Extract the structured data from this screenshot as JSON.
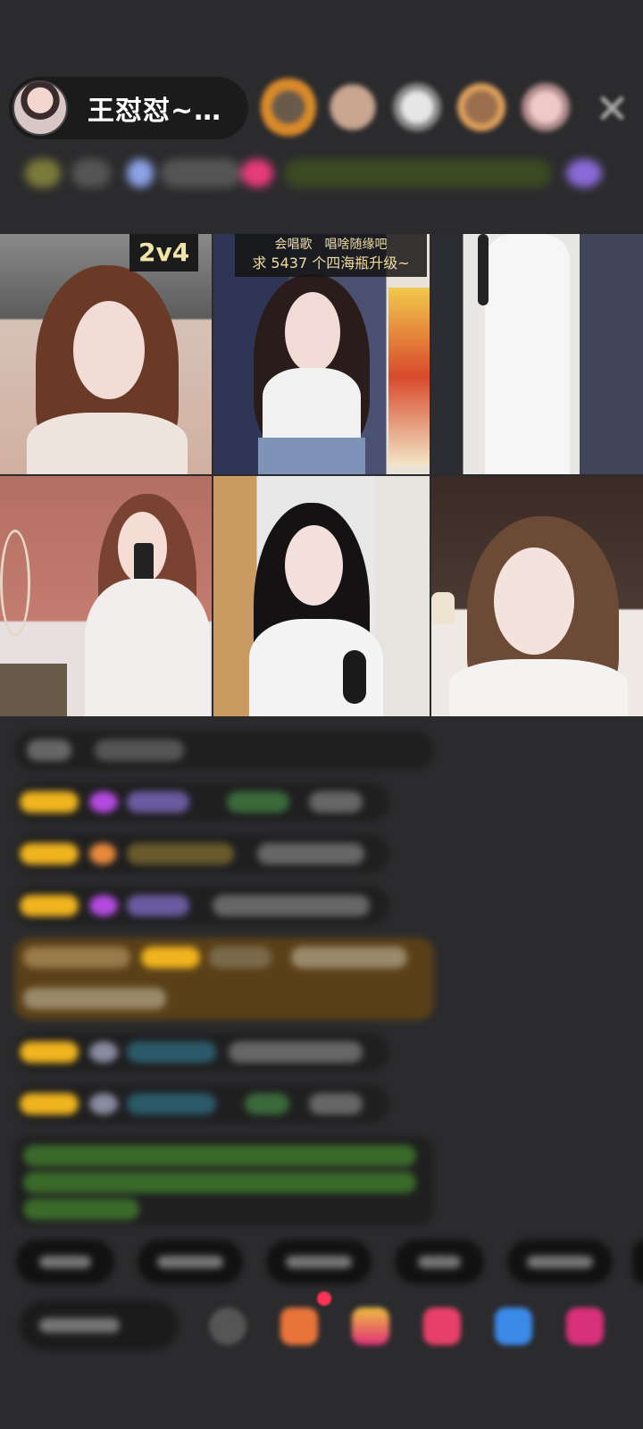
{
  "host": {
    "name": "王怼怼~…"
  },
  "pk": {
    "label": "2v4"
  },
  "banner": {
    "line1": "会唱歌　唱啥随缘吧",
    "line2": "求 5437 个四海瓶升级~"
  },
  "icons": {
    "close": "close-icon",
    "emoji": "emoji-icon",
    "gift_box": "gift-box-icon",
    "treasure": "treasure-icon",
    "game": "game-icon",
    "more": "more-icon"
  },
  "colors": {
    "background": "#2b2b2d",
    "pill": "#1b1b1c",
    "pk_label": "#f2e3a6",
    "notify_dot": "#ff3355"
  }
}
